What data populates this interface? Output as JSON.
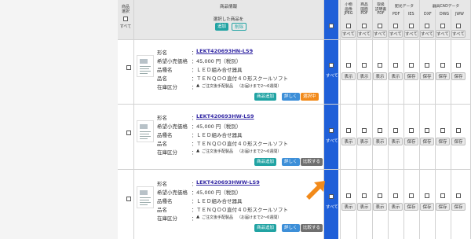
{
  "header": {
    "col_select": "商品\n選択",
    "all": "すべて",
    "product_info": "商品情報",
    "selected_products": "選択した商品を",
    "add": "追加",
    "delete": "削除",
    "small_image": "小物\n画像\nJPEG",
    "product_drawing": "商品\n図面\nPDF",
    "instruction": "取扱\n説明書\nPDF",
    "light_dist": "配光データ",
    "pdf": "PDF",
    "ies": "IES",
    "cad": "器具CADデータ",
    "dxf": "DXF",
    "dwg": "DWG",
    "jww": "JWW"
  },
  "labels": {
    "name": "形名",
    "price": "希望小売価格",
    "product_type": "品種名",
    "product_name": "品名",
    "stock": "在庫区分",
    "colon": "：",
    "show": "表示",
    "save": "保存",
    "all": "すべて"
  },
  "rows": [
    {
      "model": "LEKT420693HN-LS9",
      "price": "45,000 円（税別）",
      "type": "ＬＥＤ組み合せ器具",
      "name": "ＴＥＮＱＯＯ直付４０形スクールソフト",
      "stock_mark": "▲",
      "stock": "ご注文後手配製品",
      "stock_note": "（お届けまで2～6週間）",
      "btn_add": "商品追加",
      "btn_detail": "詳しく",
      "btn_compare": "選択中"
    },
    {
      "model": "LEKT420693HW-LS9",
      "price": "45,000 円（税別）",
      "type": "ＬＥＤ組み合せ器具",
      "name": "ＴＥＮＱＯＯ直付４０形スクールソフト",
      "stock_mark": "▲",
      "stock": "ご注文後手配製品",
      "stock_note": "（お届けまで2～6週間）",
      "btn_add": "商品追加",
      "btn_detail": "詳しく",
      "btn_compare": "比較する"
    },
    {
      "model": "LEKT420693HWW-LS9",
      "price": "45,000 円（税別）",
      "type": "ＬＥＤ組み合せ器具",
      "name": "ＴＥＮＱＯＯ直付４０形スクールソフト",
      "stock_mark": "▲",
      "stock": "ご注文後手配製品",
      "stock_note": "（お届けまで2～6週間）",
      "btn_add": "商品追加",
      "btn_detail": "詳しく",
      "btn_compare": "比較する"
    }
  ],
  "colors": {
    "blue_column": "#1f5fd8",
    "teal_button": "#21a3a3",
    "orange_button": "#f28a1a",
    "arrow": "#f28a1a"
  }
}
